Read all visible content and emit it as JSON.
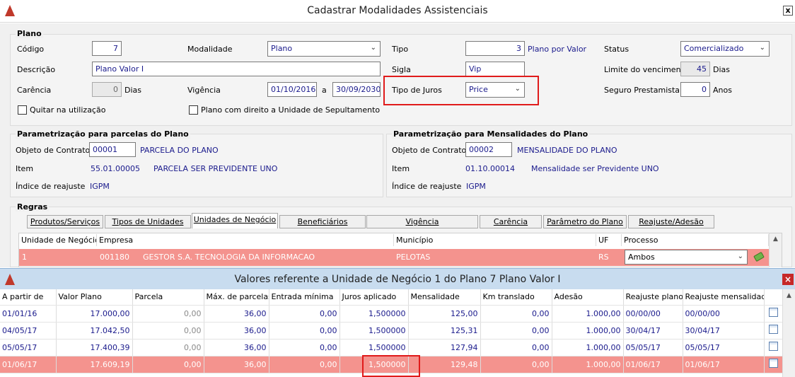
{
  "window": {
    "title": "Cadastrar Modalidades Assistenciais",
    "close": "x"
  },
  "plano": {
    "group_title": "Plano",
    "codigo_label": "Código",
    "codigo_value": "7",
    "modalidade_label": "Modalidade",
    "modalidade_value": "Plano",
    "tipo_label": "Tipo",
    "tipo_value": "3",
    "tipo_desc": "Plano por Valor",
    "status_label": "Status",
    "status_value": "Comercializado",
    "descricao_label": "Descrição",
    "descricao_value": "Plano Valor I",
    "sigla_label": "Sigla",
    "sigla_value": "Vip",
    "limite_label": "Limite do vencimento",
    "limite_value": "45",
    "limite_unit": "Dias",
    "carencia_label": "Carência",
    "carencia_value": "0",
    "carencia_unit": "Dias",
    "vigencia_label": "Vigência",
    "vigencia_from": "01/10/2016",
    "vigencia_sep": "a",
    "vigencia_to": "30/09/2030",
    "juros_label": "Tipo de Juros",
    "juros_value": "Price",
    "seguro_label": "Seguro Prestamista",
    "seguro_value": "0",
    "seguro_unit": "Anos",
    "quitar_label": "Quitar na utilização",
    "sepultamento_label": "Plano com direito a Unidade de Sepultamento"
  },
  "parcelas": {
    "title": "Parametrização para parcelas do Plano",
    "objeto_label": "Objeto de Contrato",
    "objeto_value": "00001",
    "objeto_desc": "PARCELA DO PLANO",
    "item_label": "Item",
    "item_code": "55.01.00005",
    "item_desc": "PARCELA SER PREVIDENTE UNO",
    "indice_label": "Índice de reajuste",
    "indice_value": "IGPM"
  },
  "mensalidades": {
    "title": "Parametrização para Mensalidades do Plano",
    "objeto_label": "Objeto de Contrato",
    "objeto_value": "00002",
    "objeto_desc": "MENSALIDADE DO PLANO",
    "item_label": "Item",
    "item_code": "01.10.00014",
    "item_desc": "Mensalidade ser Previdente UNO",
    "indice_label": "Índice de reajuste",
    "indice_value": "IGPM"
  },
  "regras": {
    "title": "Regras",
    "tabs": [
      "Produtos/Serviços",
      "Tipos de Unidades",
      "Unidades de Negócio",
      "Beneficiários",
      "Vigência",
      "Carência",
      "Parâmetro do Plano",
      "Reajuste/Adesão"
    ],
    "grid_headers": [
      "Unidade de Negócio",
      "Empresa",
      "Município",
      "UF",
      "Processo"
    ],
    "row": {
      "unidade": "1",
      "empresa_code": "001180",
      "empresa_name": "GESTOR S.A. TECNOLOGIA DA INFORMACAO",
      "municipio": "PELOTAS",
      "uf": "RS",
      "processo": "Ambos"
    }
  },
  "valores": {
    "title": "Valores referente a Unidade de Negócio 1   do Plano 7 Plano Valor I",
    "headers": [
      "A partir de",
      "Valor Plano",
      "Parcela",
      "Máx. de parcelas",
      "Entrada mínima",
      "Juros aplicado",
      "Mensalidade",
      "Km translado",
      "Adesão",
      "Reajuste plano",
      "Reajuste mensalidade"
    ],
    "rows": [
      [
        "01/01/16",
        "17.000,00",
        "0,00",
        "36,00",
        "0,00",
        "1,500000",
        "125,00",
        "0,00",
        "1.000,00",
        "00/00/00",
        "00/00/00"
      ],
      [
        "04/05/17",
        "17.042,50",
        "0,00",
        "36,00",
        "0,00",
        "1,500000",
        "125,31",
        "0,00",
        "1.000,00",
        "30/04/17",
        "30/04/17"
      ],
      [
        "05/05/17",
        "17.400,39",
        "0,00",
        "36,00",
        "0,00",
        "1,500000",
        "127,94",
        "0,00",
        "1.000,00",
        "05/05/17",
        "05/05/17"
      ],
      [
        "01/06/17",
        "17.609,19",
        "0,00",
        "36,00",
        "0,00",
        "1,500000",
        "129,48",
        "0,00",
        "1.000,00",
        "01/06/17",
        "01/06/17"
      ]
    ]
  },
  "colors": {
    "selected_row": "#f4938e",
    "highlight": "#e01b1b",
    "value_text": "#1a1a8c"
  }
}
